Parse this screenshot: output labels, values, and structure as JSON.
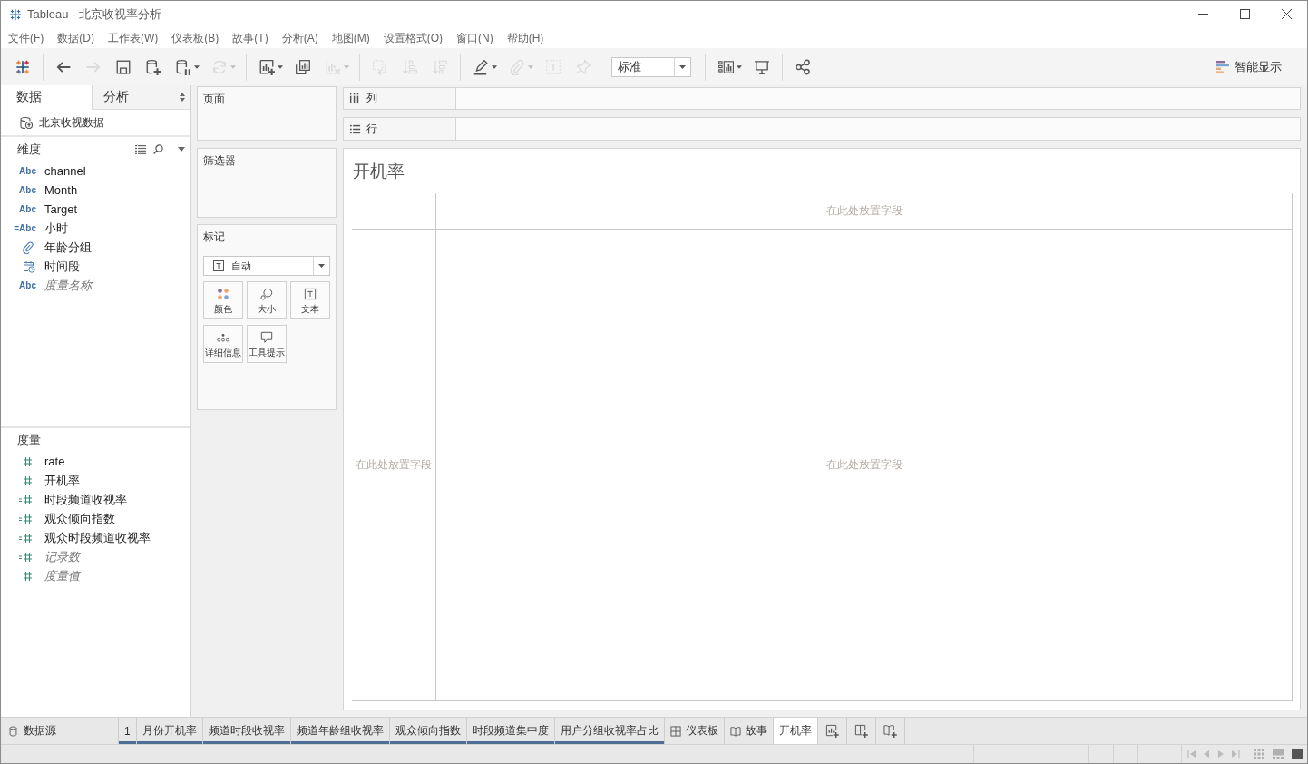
{
  "window": {
    "title": "Tableau - 北京收视率分析"
  },
  "menu": [
    "文件(F)",
    "数据(D)",
    "工作表(W)",
    "仪表板(B)",
    "故事(T)",
    "分析(A)",
    "地图(M)",
    "设置格式(O)",
    "窗口(N)",
    "帮助(H)"
  ],
  "toolbar": {
    "groups": [
      [
        {
          "kind": "start",
          "disabled": false,
          "dropdown": false
        }
      ],
      [
        {
          "kind": "undo",
          "disabled": false,
          "dropdown": false
        },
        {
          "kind": "redo",
          "disabled": true,
          "dropdown": false
        },
        {
          "kind": "save",
          "disabled": false,
          "dropdown": false
        },
        {
          "kind": "new_datasource",
          "disabled": false,
          "dropdown": false
        },
        {
          "kind": "pause",
          "disabled": false,
          "dropdown": true
        },
        {
          "kind": "refresh",
          "disabled": true,
          "dropdown": true
        }
      ],
      [
        {
          "kind": "new_worksheet",
          "disabled": false,
          "dropdown": true
        },
        {
          "kind": "duplicate",
          "disabled": false,
          "dropdown": false
        },
        {
          "kind": "clear",
          "disabled": true,
          "dropdown": true
        }
      ],
      [
        {
          "kind": "swap",
          "disabled": true,
          "dropdown": false
        },
        {
          "kind": "sort_ascending",
          "disabled": true,
          "dropdown": false
        },
        {
          "kind": "sort_descending",
          "disabled": true,
          "dropdown": false
        }
      ],
      [
        {
          "kind": "highlight",
          "disabled": false,
          "dropdown": true
        },
        {
          "kind": "group",
          "disabled": true,
          "dropdown": true
        },
        {
          "kind": "labels",
          "disabled": true,
          "dropdown": false
        },
        {
          "kind": "pin",
          "disabled": true,
          "dropdown": false
        },
        {
          "kind": "fit",
          "value": "标准"
        }
      ],
      [
        {
          "kind": "cards",
          "disabled": false,
          "dropdown": true
        },
        {
          "kind": "presentation",
          "disabled": false,
          "dropdown": false
        }
      ],
      [
        {
          "kind": "share",
          "disabled": false,
          "dropdown": false
        }
      ]
    ],
    "show_me": {
      "label": "智能显示"
    }
  },
  "data_pane": {
    "tabs": [
      {
        "label": "数据",
        "selected": true
      },
      {
        "label": "分析",
        "selected": false
      }
    ],
    "datasource": "北京收视数据",
    "dimensions": {
      "title": "维度",
      "fields": [
        {
          "name": "channel",
          "kind": "string",
          "type_label": "Abc",
          "generated": false
        },
        {
          "name": "Month",
          "kind": "string",
          "type_label": "Abc",
          "generated": false
        },
        {
          "name": "Target",
          "kind": "string",
          "type_label": "Abc",
          "generated": false
        },
        {
          "name": "小时",
          "kind": "string",
          "type_label": "=Abc",
          "generated": false
        },
        {
          "name": "年龄分组",
          "kind": "group",
          "generated": false
        },
        {
          "name": "时间段",
          "kind": "datetime",
          "generated": false
        },
        {
          "name": "度量名称",
          "kind": "string",
          "type_label": "Abc",
          "generated": true
        }
      ]
    },
    "measures": {
      "title": "度量",
      "fields": [
        {
          "name": "rate",
          "kind": "number",
          "calculated": false,
          "generated": false
        },
        {
          "name": "开机率",
          "kind": "number",
          "calculated": false,
          "generated": false
        },
        {
          "name": "时段频道收视率",
          "kind": "number",
          "calculated": true,
          "generated": false
        },
        {
          "name": "观众倾向指数",
          "kind": "number",
          "calculated": true,
          "generated": false
        },
        {
          "name": "观众时段频道收视率",
          "kind": "number",
          "calculated": true,
          "generated": false
        },
        {
          "name": "记录数",
          "kind": "number",
          "calculated": true,
          "generated": true
        },
        {
          "name": "度量值",
          "kind": "number",
          "calculated": false,
          "generated": true
        }
      ]
    }
  },
  "cards": {
    "pages": {
      "title": "页面"
    },
    "filters": {
      "title": "筛选器"
    },
    "marks": {
      "title": "标记",
      "mark_type": "自动",
      "buttons": [
        {
          "kind": "color",
          "label": "颜色"
        },
        {
          "kind": "size",
          "label": "大小"
        },
        {
          "kind": "text",
          "label": "文本"
        },
        {
          "kind": "detail",
          "label": "详细信息"
        },
        {
          "kind": "tooltip",
          "label": "工具提示"
        }
      ]
    }
  },
  "shelves": [
    {
      "kind": "columns",
      "label": "列"
    },
    {
      "kind": "rows",
      "label": "行"
    }
  ],
  "view": {
    "title": "开机率",
    "column_drop_hint": "在此处放置字段",
    "row_drop_hint": "在此处放置字段",
    "body_drop_hint": "在此处放置字段"
  },
  "sheet_tabs": [
    {
      "kind": "datasource",
      "label": "数据源",
      "used": false,
      "selected": false
    },
    {
      "kind": "worksheet",
      "label": "1",
      "used": true,
      "selected": false
    },
    {
      "kind": "worksheet",
      "label": "月份开机率",
      "used": true,
      "selected": false
    },
    {
      "kind": "worksheet",
      "label": "频道时段收视率",
      "used": true,
      "selected": false
    },
    {
      "kind": "worksheet",
      "label": "频道年龄组收视率",
      "used": true,
      "selected": false
    },
    {
      "kind": "worksheet",
      "label": "观众倾向指数",
      "used": true,
      "selected": false
    },
    {
      "kind": "worksheet",
      "label": "时段频道集中度",
      "used": true,
      "selected": false
    },
    {
      "kind": "worksheet",
      "label": "用户分组收视率占比",
      "used": true,
      "selected": false
    },
    {
      "kind": "dashboard",
      "label": "仪表板",
      "used": false,
      "selected": false
    },
    {
      "kind": "story",
      "label": "故事",
      "used": false,
      "selected": false
    },
    {
      "kind": "worksheet",
      "label": "开机率",
      "used": false,
      "selected": true
    }
  ],
  "status_bar": {
    "nav_buttons": [
      {
        "kind": "first",
        "disabled": true
      },
      {
        "kind": "previous",
        "disabled": true
      },
      {
        "kind": "next",
        "disabled": true
      },
      {
        "kind": "last",
        "disabled": true
      }
    ],
    "view_modes": [
      {
        "kind": "sorter",
        "selected": false
      },
      {
        "kind": "filmstrip",
        "selected": false
      },
      {
        "kind": "tabs",
        "selected": true
      }
    ]
  }
}
